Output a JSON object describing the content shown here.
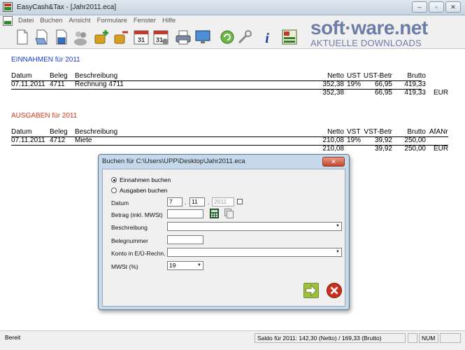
{
  "window": {
    "title": "EasyCash&Tax - [Jahr2011.eca]",
    "buttons": [
      "–",
      "▫",
      "✕"
    ]
  },
  "menu": [
    "Datei",
    "Buchen",
    "Ansicht",
    "Formulare",
    "Fenster",
    "Hilfe"
  ],
  "toolbar": {
    "icons": [
      "new-document-icon",
      "open-icon",
      "save-icon",
      "users-icon",
      "add-income-icon",
      "add-expense-icon",
      "calendar-31-icon",
      "calendar-settings-icon",
      "print-icon",
      "monitor-icon",
      "refresh-icon",
      "tools-icon",
      "info-icon",
      "tax-form-icon"
    ],
    "calendar_day": "31",
    "calendar_day2": "31",
    "info_glyph": "i"
  },
  "watermark": {
    "main": "soft·ware.net",
    "sub": "AKTUELLE DOWNLOADS"
  },
  "income": {
    "title": "EINNAHMEN für 2011",
    "headers": {
      "datum": "Datum",
      "beleg": "Beleg",
      "beschreibung": "Beschreibung",
      "netto": "Netto",
      "ust": "UST",
      "ust_betr": "UST-Betr",
      "brutto": "Brutto"
    },
    "rows": [
      {
        "datum": "07.11.2011",
        "beleg": "4711",
        "beschreibung": "Rechnung 4711",
        "netto": "352,38",
        "ust": "19%",
        "ust_betr": "66,95",
        "brutto": "419,33"
      }
    ],
    "totals": {
      "netto": "352,38",
      "ust_betr": "66,95",
      "brutto": "419,33",
      "currency": "EUR"
    }
  },
  "expenses": {
    "title": "AUSGABEN für 2011",
    "headers": {
      "datum": "Datum",
      "beleg": "Beleg",
      "beschreibung": "Beschreibung",
      "netto": "Netto",
      "vst": "VST",
      "vst_betr": "VST-Betr",
      "brutto": "Brutto",
      "afa": "AfANr"
    },
    "rows": [
      {
        "datum": "07.11.2011",
        "beleg": "4712",
        "beschreibung": "Miete",
        "netto": "210,08",
        "vst": "19%",
        "vst_betr": "39,92",
        "brutto": "250,00"
      }
    ],
    "totals": {
      "netto": "210,08",
      "vst_betr": "39,92",
      "brutto": "250,00",
      "currency": "EUR"
    }
  },
  "dialog": {
    "title": "Buchen für C:\\Users\\UPP\\Desktop\\Jahr2011.eca",
    "close": "✕",
    "radio_income": "Einnahmen buchen",
    "radio_expense": "Ausgaben buchen",
    "radio_income_selected": true,
    "label_datum": "Datum",
    "datum_day": "7",
    "datum_month": "11",
    "datum_year": "2011",
    "label_betrag": "Betrag (inkl. MWSt)",
    "betrag_value": "",
    "label_beschreibung": "Beschreibung",
    "beschreibung_value": "",
    "label_belegnummer": "Belegnummer",
    "belegnummer_value": "",
    "label_konto": "Konto in E/Ü-Rechn.",
    "konto_value": "",
    "label_mwst": "MWSt (%)",
    "mwst_value": "19"
  },
  "status": {
    "ready": "Bereit",
    "saldo": "Saldo für 2011: 142,30 (Netto) / 169,33 (Brutto)",
    "num": "NUM"
  }
}
